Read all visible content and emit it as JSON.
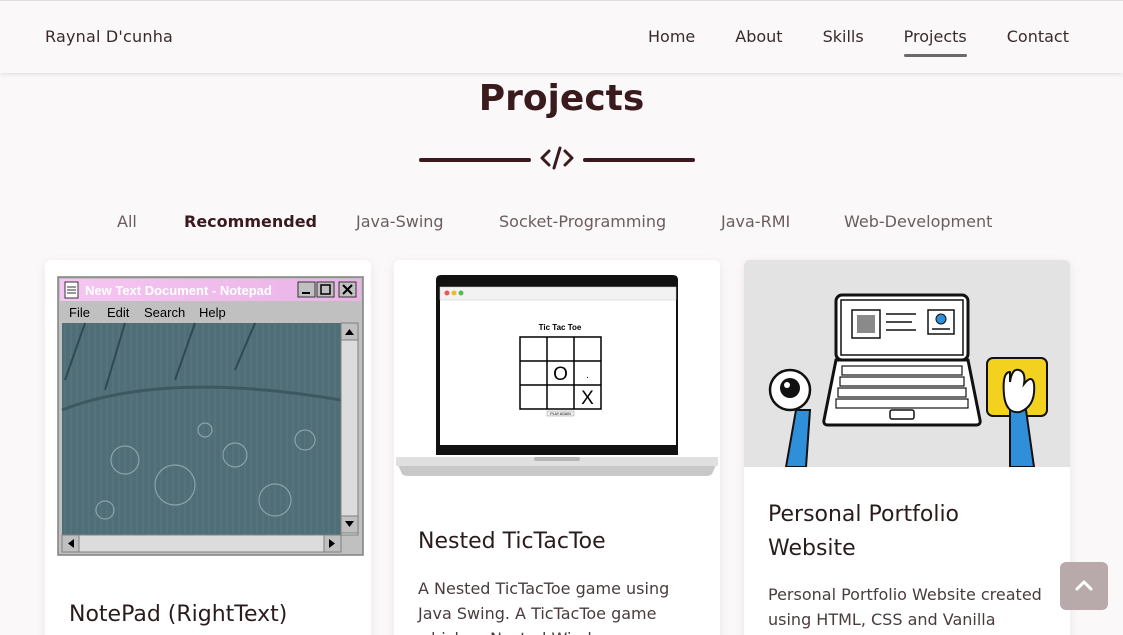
{
  "brand": "Raynal D'cunha",
  "nav": {
    "items": [
      {
        "label": "Home"
      },
      {
        "label": "About"
      },
      {
        "label": "Skills"
      },
      {
        "label": "Projects"
      },
      {
        "label": "Contact"
      }
    ],
    "active": "Projects"
  },
  "section": {
    "title": "Projects",
    "icon": "code-icon"
  },
  "filters": [
    "All",
    "Recommended",
    "Java-Swing",
    "Socket-Programming",
    "Java-RMI",
    "Web-Development"
  ],
  "active_filter": "Recommended",
  "notepad": {
    "window_title": "New Text Document - Notepad",
    "menu": [
      "File",
      "Edit",
      "Search",
      "Help"
    ]
  },
  "tictactoe": {
    "title": "Tic Tac Toe",
    "cells": [
      "",
      "",
      "",
      "",
      "O",
      "·",
      "",
      "",
      "X"
    ],
    "button": "PLAY AGAIN"
  },
  "projects": [
    {
      "title": "NotePad (RightText)",
      "description": ""
    },
    {
      "title": "Nested TicTacToe",
      "description": "A Nested TicTacToe game using Java Swing. A TicTacToe game which ... Nested Wind"
    },
    {
      "title": "Personal Portfolio Website",
      "description": "Personal Portfolio Website created using HTML, CSS and Vanilla"
    }
  ],
  "colors": {
    "accent": "#3a1a1d",
    "background": "#fbf8f9",
    "scroll_button": "#b8a9aa"
  },
  "icons": {
    "scroll_top": "chevron-up-icon"
  }
}
